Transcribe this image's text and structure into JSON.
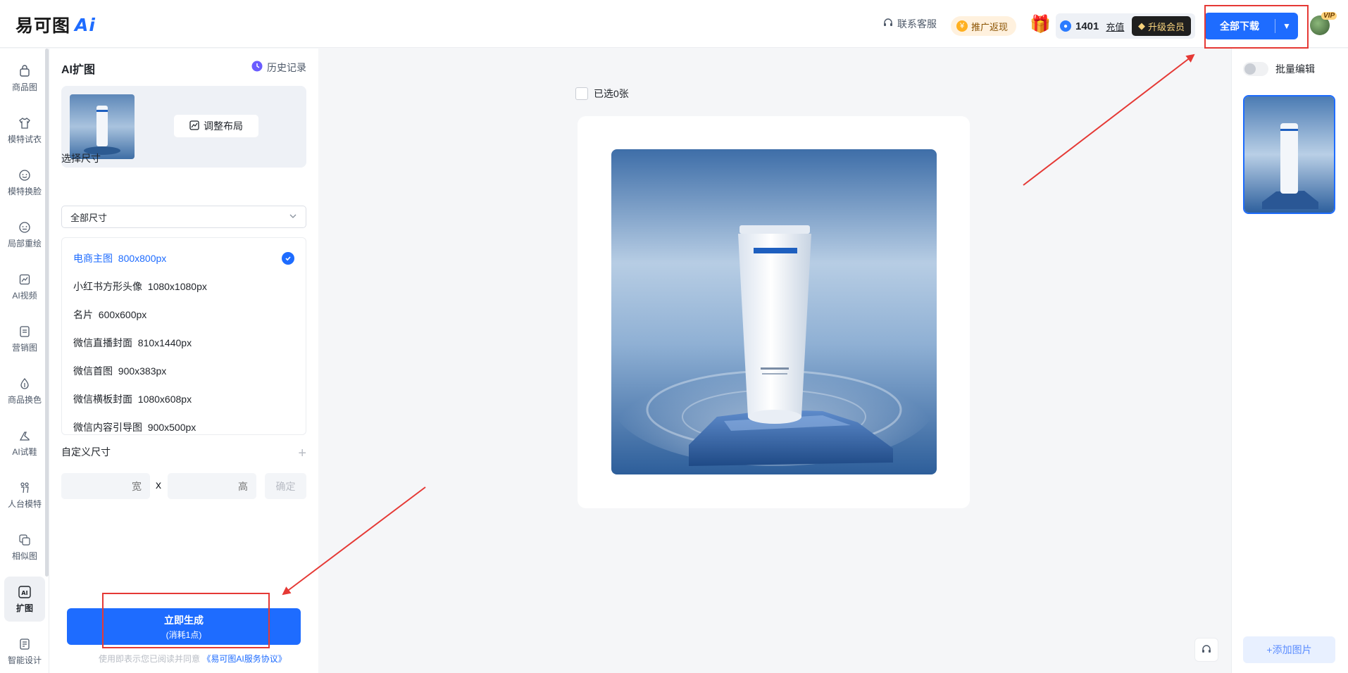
{
  "header": {
    "logo_text": "易可图",
    "logo_ai": "Ai",
    "contact": "联系客服",
    "promo": "推广返现",
    "points": "1401",
    "recharge": "充值",
    "vip_upgrade": "升级会员",
    "download_all": "全部下载",
    "vip_badge": "VIP"
  },
  "nav": {
    "items": [
      {
        "label": "商品图",
        "icon": "bag-icon"
      },
      {
        "label": "模特试衣",
        "icon": "shirt-icon"
      },
      {
        "label": "模特换脸",
        "icon": "face-icon"
      },
      {
        "label": "局部重绘",
        "icon": "face-edit-icon"
      },
      {
        "label": "AI视频",
        "icon": "video-icon"
      },
      {
        "label": "营销图",
        "icon": "poster-icon"
      },
      {
        "label": "商品换色",
        "icon": "drop-icon"
      },
      {
        "label": "AI试鞋",
        "icon": "shoe-icon"
      },
      {
        "label": "人台模特",
        "icon": "mannequin-icon"
      },
      {
        "label": "相似图",
        "icon": "similar-icon"
      },
      {
        "label": "扩图",
        "icon": "expand-ai-icon"
      },
      {
        "label": "智能设计",
        "icon": "design-icon"
      }
    ]
  },
  "panel": {
    "title": "AI扩图",
    "history": "历史记录",
    "adjust_layout": "调整布局",
    "select_size_label": "选择尺寸",
    "size_select_value": "全部尺寸",
    "sizes": [
      {
        "name": "电商主图",
        "dims": "800x800px"
      },
      {
        "name": "小红书方形头像",
        "dims": "1080x1080px"
      },
      {
        "name": "名片",
        "dims": "600x600px"
      },
      {
        "name": "微信直播封面",
        "dims": "810x1440px"
      },
      {
        "name": "微信首图",
        "dims": "900x383px"
      },
      {
        "name": "微信横板封面",
        "dims": "1080x608px"
      },
      {
        "name": "微信内容引导图",
        "dims": "900x500px"
      }
    ],
    "selected_size_index": 0,
    "custom_size_label": "自定义尺寸",
    "width_placeholder": "宽",
    "height_placeholder": "高",
    "times": "x",
    "confirm": "确定",
    "generate": "立即生成",
    "generate_cost": "(消耗1点)",
    "agreement_prefix": "使用即表示您已阅读并同意",
    "agreement_link": "《易可图AI服务协议》"
  },
  "canvas": {
    "selected_count": "已选0张"
  },
  "right": {
    "batch_edit": "批量编辑",
    "add_image": "+添加图片"
  },
  "colors": {
    "accent": "#1e6cff",
    "annotation": "#e53935"
  }
}
